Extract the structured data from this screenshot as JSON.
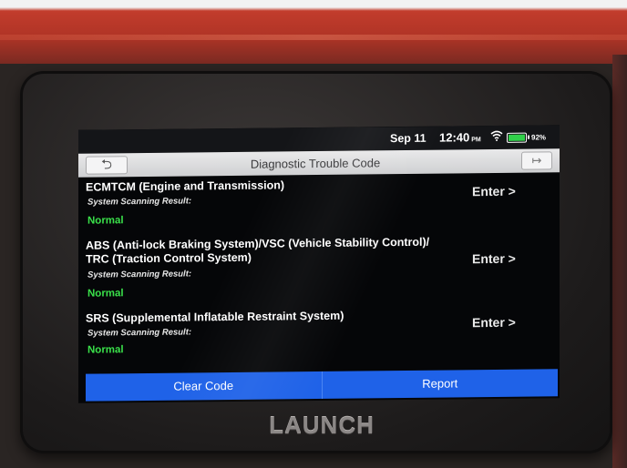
{
  "status_bar": {
    "date": "Sep 11",
    "time": "12:40",
    "ampm": "PM",
    "battery_percent": "92%",
    "battery_level": 0.92,
    "icons": [
      "wifi-icon",
      "battery-icon"
    ]
  },
  "title_bar": {
    "title": "Diagnostic Trouble Code",
    "back_icon": "back-arrow-icon",
    "exit_icon": "exit-icon"
  },
  "systems": [
    {
      "name": "ECMTCM (Engine and Transmission)",
      "scan_label": "System Scanning Result:",
      "result": "Normal",
      "enter_label": "Enter >"
    },
    {
      "name": "ABS (Anti-lock Braking System)/VSC (Vehicle Stability Control)/ TRC (Traction Control System)",
      "scan_label": "System Scanning Result:",
      "result": "Normal",
      "enter_label": "Enter >"
    },
    {
      "name": "SRS (Supplemental Inflatable Restraint System)",
      "scan_label": "System Scanning Result:",
      "result": "Normal",
      "enter_label": "Enter >"
    }
  ],
  "bottom_bar": {
    "clear_code": "Clear Code",
    "report": "Report"
  },
  "device": {
    "brand": "LAUNCH"
  },
  "colors": {
    "accent_blue": "#1f62e8",
    "normal_green": "#3ae04a",
    "screen_bg": "#050608",
    "case_red": "#b03426"
  }
}
